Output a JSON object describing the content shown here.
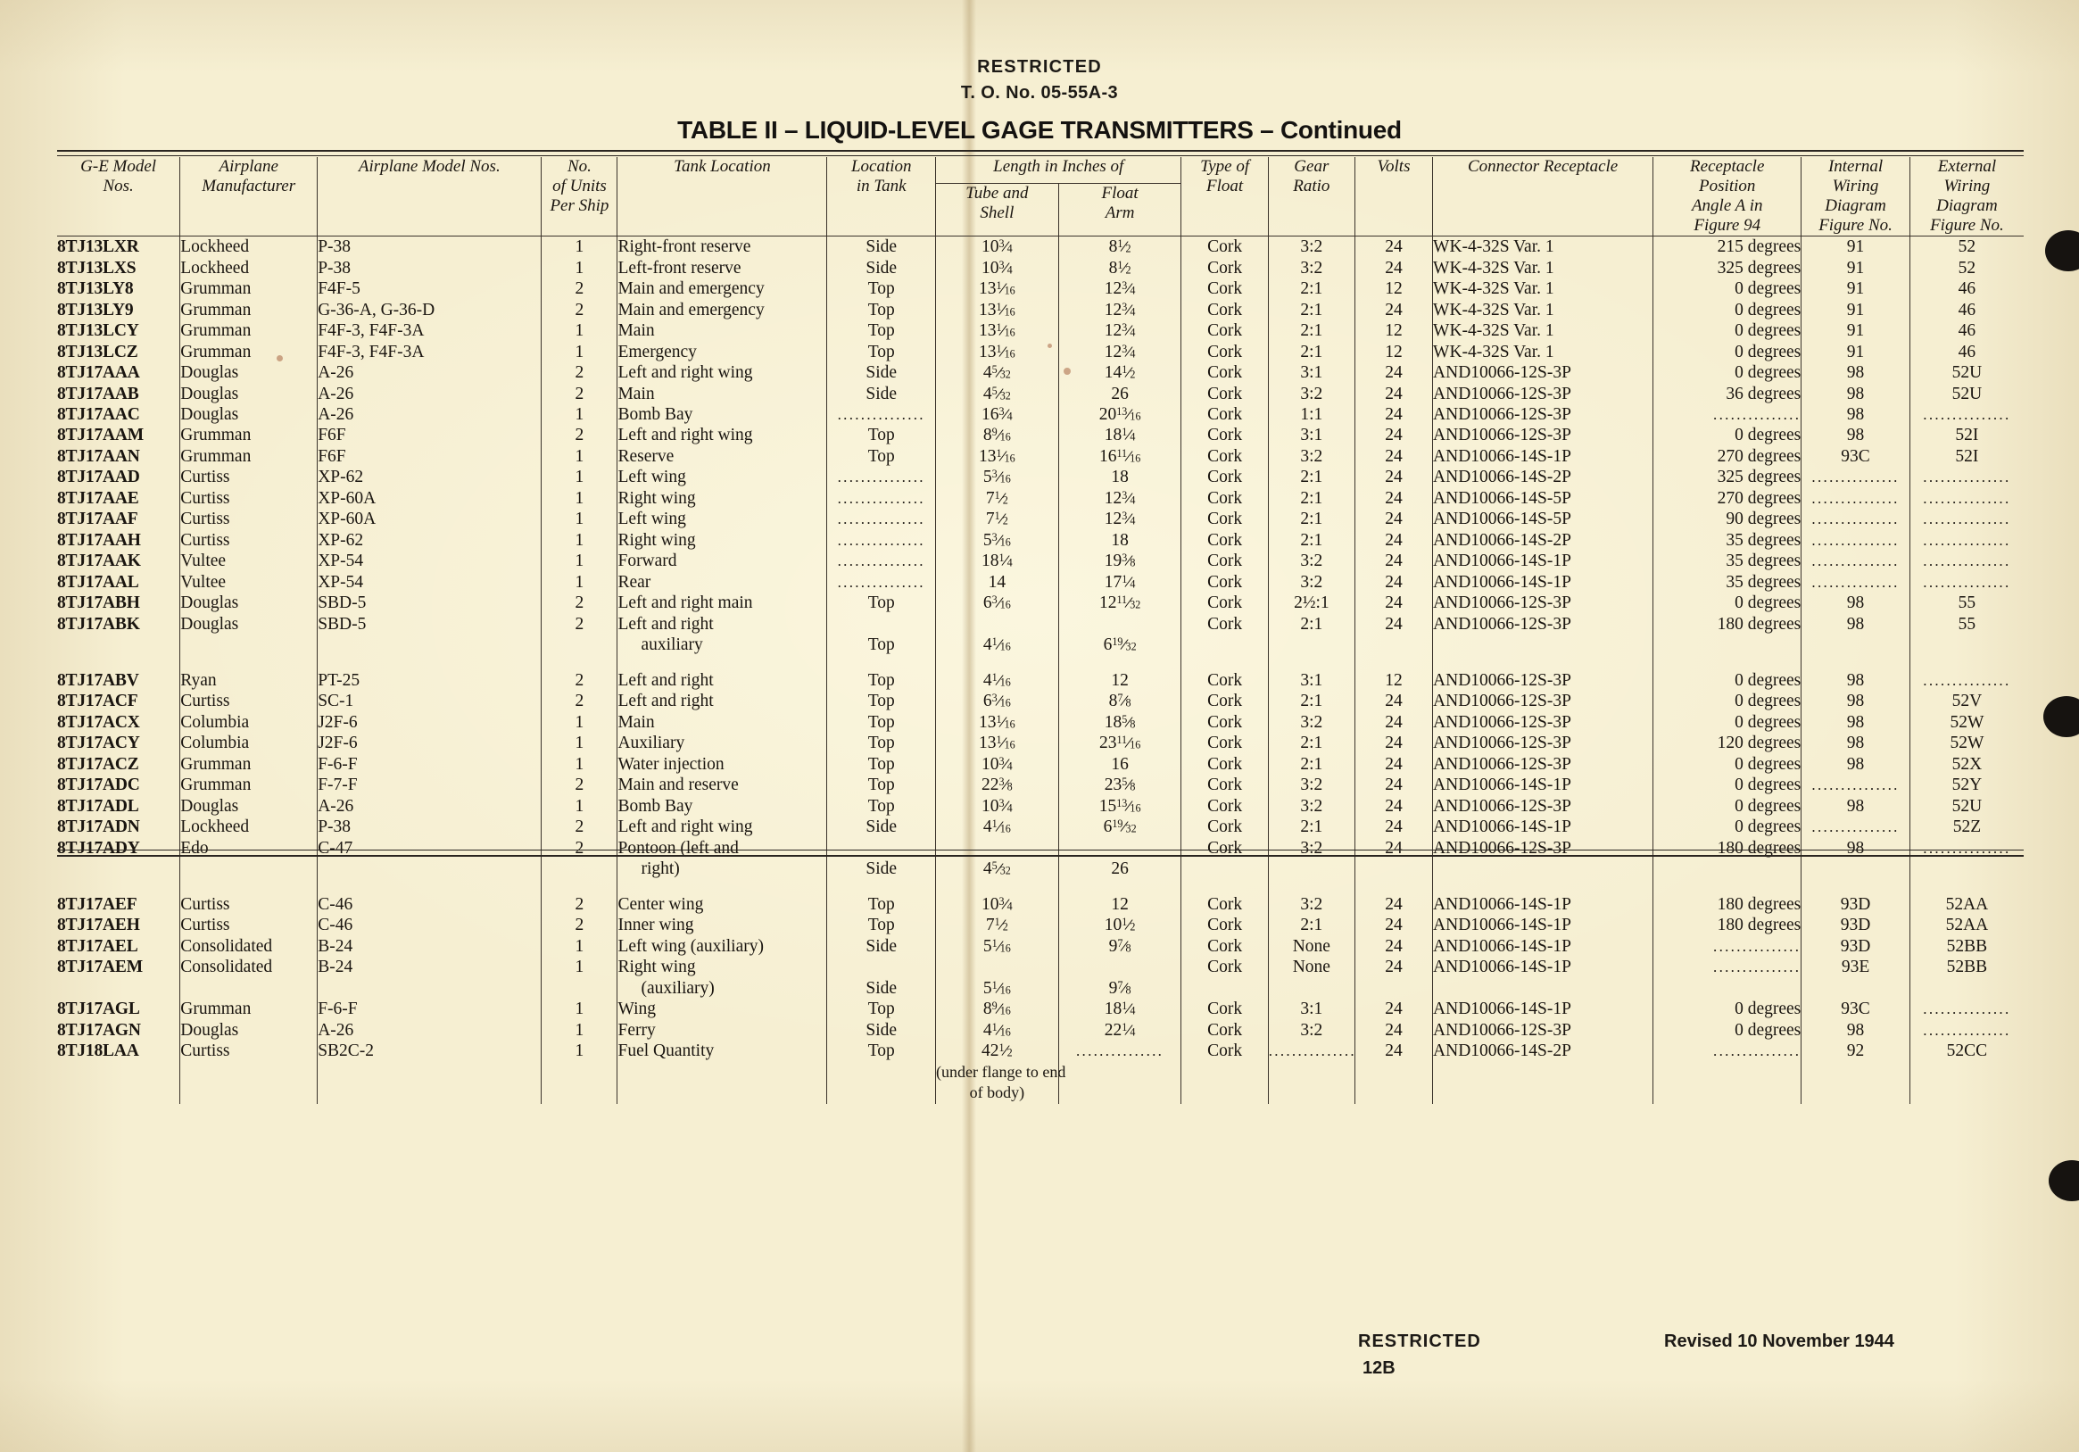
{
  "header": {
    "restricted": "RESTRICTED",
    "to_number": "T. O. No. 05-55A-3",
    "table_title": "TABLE II – LIQUID-LEVEL GAGE TRANSMITTERS – Continued"
  },
  "footer": {
    "restricted": "RESTRICTED",
    "page_number": "12B",
    "revised": "Revised 10 November 1944"
  },
  "table": {
    "columns": {
      "ge_model": "G-E Model Nos.",
      "manufacturer": "Airplane Manufacturer",
      "airplane_models": "Airplane Model Nos.",
      "units_per_ship": "No. of Units Per Ship",
      "tank_location": "Tank Location",
      "location_in_tank": "Location in Tank",
      "length_group": "Length in Inches of",
      "tube_and_shell": "Tube and Shell",
      "float_arm": "Float Arm",
      "type_of_float": "Type of Float",
      "gear_ratio": "Gear Ratio",
      "volts": "Volts",
      "connector_receptacle": "Connector Receptacle",
      "receptacle_position": "Receptacle Position Angle A in Figure 94",
      "internal_wiring": "Internal Wiring Diagram Figure No.",
      "external_wiring": "External Wiring Diagram Figure No."
    },
    "header_lines": {
      "ge_model": [
        "G-E Model",
        "Nos."
      ],
      "manufacturer": [
        "Airplane",
        "Manufacturer"
      ],
      "airplane_models": [
        "Airplane Model Nos."
      ],
      "units_per_ship": [
        "No.",
        "of Units",
        "Per Ship"
      ],
      "tank_location": [
        "Tank Location"
      ],
      "location_in_tank": [
        "Location",
        "in Tank"
      ],
      "length_group": [
        "Length in Inches of"
      ],
      "tube_and_shell": [
        "Tube and",
        "Shell"
      ],
      "float_arm": [
        "Float",
        "Arm"
      ],
      "type_of_float": [
        "Type of",
        "Float"
      ],
      "gear_ratio": [
        "Gear",
        "Ratio"
      ],
      "volts": [
        "Volts"
      ],
      "connector_receptacle": [
        "Connector Receptacle"
      ],
      "receptacle_position": [
        "Receptacle",
        "Position",
        "Angle A in",
        "Figure 94"
      ],
      "internal_wiring": [
        "Internal",
        "Wiring",
        "Diagram",
        "Figure No."
      ],
      "external_wiring": [
        "External",
        "Wiring",
        "Diagram",
        "Figure No."
      ]
    },
    "dots": "...............",
    "rows": [
      {
        "ge": "8TJ13LXR",
        "mfr": "Lockheed",
        "models": "P-38",
        "units": "1",
        "tank": "Right-front reserve",
        "loc": "Side",
        "tube": "10|3|4",
        "float": "8|1|2",
        "type": "Cork",
        "gear": "3:2",
        "volts": "24",
        "conn": "WK-4-32S Var. 1",
        "angle": "215 degrees",
        "intw": "91",
        "extw": "52"
      },
      {
        "ge": "8TJ13LXS",
        "mfr": "Lockheed",
        "models": "P-38",
        "units": "1",
        "tank": "Left-front reserve",
        "loc": "Side",
        "tube": "10|3|4",
        "float": "8|1|2",
        "type": "Cork",
        "gear": "3:2",
        "volts": "24",
        "conn": "WK-4-32S Var. 1",
        "angle": "325 degrees",
        "intw": "91",
        "extw": "52"
      },
      {
        "ge": "8TJ13LY8",
        "mfr": "Grumman",
        "models": "F4F-5",
        "units": "2",
        "tank": "Main and emergency",
        "loc": "Top",
        "tube": "13|1|16",
        "float": "12|3|4",
        "type": "Cork",
        "gear": "2:1",
        "volts": "12",
        "conn": "WK-4-32S Var. 1",
        "angle": "0 degrees",
        "intw": "91",
        "extw": "46"
      },
      {
        "ge": "8TJ13LY9",
        "mfr": "Grumman",
        "models": "G-36-A, G-36-D",
        "units": "2",
        "tank": "Main and emergency",
        "loc": "Top",
        "tube": "13|1|16",
        "float": "12|3|4",
        "type": "Cork",
        "gear": "2:1",
        "volts": "24",
        "conn": "WK-4-32S Var. 1",
        "angle": "0 degrees",
        "intw": "91",
        "extw": "46"
      },
      {
        "ge": "8TJ13LCY",
        "mfr": "Grumman",
        "models": "F4F-3, F4F-3A",
        "units": "1",
        "tank": "Main",
        "loc": "Top",
        "tube": "13|1|16",
        "float": "12|3|4",
        "type": "Cork",
        "gear": "2:1",
        "volts": "12",
        "conn": "WK-4-32S Var. 1",
        "angle": "0 degrees",
        "intw": "91",
        "extw": "46"
      },
      {
        "ge": "8TJ13LCZ",
        "mfr": "Grumman",
        "models": "F4F-3, F4F-3A",
        "units": "1",
        "tank": "Emergency",
        "loc": "Top",
        "tube": "13|1|16",
        "float": "12|3|4",
        "type": "Cork",
        "gear": "2:1",
        "volts": "12",
        "conn": "WK-4-32S Var. 1",
        "angle": "0 degrees",
        "intw": "91",
        "extw": "46"
      },
      {
        "ge": "8TJ17AAA",
        "mfr": "Douglas",
        "models": "A-26",
        "units": "2",
        "tank": "Left and right wing",
        "loc": "Side",
        "tube": "4|5|32",
        "float": "14|1|2",
        "type": "Cork",
        "gear": "3:1",
        "volts": "24",
        "conn": "AND10066-12S-3P",
        "angle": "0 degrees",
        "intw": "98",
        "extw": "52U"
      },
      {
        "ge": "8TJ17AAB",
        "mfr": "Douglas",
        "models": "A-26",
        "units": "2",
        "tank": "Main",
        "loc": "Side",
        "tube": "4|5|32",
        "float": "26",
        "type": "Cork",
        "gear": "3:2",
        "volts": "24",
        "conn": "AND10066-12S-3P",
        "angle": "36 degrees",
        "intw": "98",
        "extw": "52U"
      },
      {
        "ge": "8TJ17AAC",
        "mfr": "Douglas",
        "models": "A-26",
        "units": "1",
        "tank": "Bomb Bay",
        "loc": "DOTS",
        "tube": "16|3|4",
        "float": "20|13|16",
        "type": "Cork",
        "gear": "1:1",
        "volts": "24",
        "conn": "AND10066-12S-3P",
        "angle": "DOTS",
        "intw": "98",
        "extw": "DOTS"
      },
      {
        "ge": "8TJ17AAM",
        "mfr": "Grumman",
        "models": "F6F",
        "units": "2",
        "tank": "Left and right wing",
        "loc": "Top",
        "tube": "8|9|16",
        "float": "18|1|4",
        "type": "Cork",
        "gear": "3:1",
        "volts": "24",
        "conn": "AND10066-12S-3P",
        "angle": "0 degrees",
        "intw": "98",
        "extw": "52I"
      },
      {
        "ge": "8TJ17AAN",
        "mfr": "Grumman",
        "models": "F6F",
        "units": "1",
        "tank": "Reserve",
        "loc": "Top",
        "tube": "13|1|16",
        "float": "16|11|16",
        "type": "Cork",
        "gear": "3:2",
        "volts": "24",
        "conn": "AND10066-14S-1P",
        "angle": "270 degrees",
        "intw": "93C",
        "extw": "52I"
      },
      {
        "ge": "8TJ17AAD",
        "mfr": "Curtiss",
        "models": "XP-62",
        "units": "1",
        "tank": "Left wing",
        "loc": "DOTS",
        "tube": "5|3|16",
        "float": "18",
        "type": "Cork",
        "gear": "2:1",
        "volts": "24",
        "conn": "AND10066-14S-2P",
        "angle": "325 degrees",
        "intw": "DOTS",
        "extw": "DOTS"
      },
      {
        "ge": "8TJ17AAE",
        "mfr": "Curtiss",
        "models": "XP-60A",
        "units": "1",
        "tank": "Right wing",
        "loc": "DOTS",
        "tube": "7|1|2",
        "float": "12|3|4",
        "type": "Cork",
        "gear": "2:1",
        "volts": "24",
        "conn": "AND10066-14S-5P",
        "angle": "270 degrees",
        "intw": "DOTS",
        "extw": "DOTS"
      },
      {
        "ge": "8TJ17AAF",
        "mfr": "Curtiss",
        "models": "XP-60A",
        "units": "1",
        "tank": "Left wing",
        "loc": "DOTS",
        "tube": "7|1|2",
        "float": "12|3|4",
        "type": "Cork",
        "gear": "2:1",
        "volts": "24",
        "conn": "AND10066-14S-5P",
        "angle": "90 degrees",
        "intw": "DOTS",
        "extw": "DOTS"
      },
      {
        "ge": "8TJ17AAH",
        "mfr": "Curtiss",
        "models": "XP-62",
        "units": "1",
        "tank": "Right wing",
        "loc": "DOTS",
        "tube": "5|3|16",
        "float": "18",
        "type": "Cork",
        "gear": "2:1",
        "volts": "24",
        "conn": "AND10066-14S-2P",
        "angle": "35 degrees",
        "intw": "DOTS",
        "extw": "DOTS"
      },
      {
        "ge": "8TJ17AAK",
        "mfr": "Vultee",
        "models": "XP-54",
        "units": "1",
        "tank": "Forward",
        "loc": "DOTS",
        "tube": "18|1|4",
        "float": "19|3|8",
        "type": "Cork",
        "gear": "3:2",
        "volts": "24",
        "conn": "AND10066-14S-1P",
        "angle": "35 degrees",
        "intw": "DOTS",
        "extw": "DOTS"
      },
      {
        "ge": "8TJ17AAL",
        "mfr": "Vultee",
        "models": "XP-54",
        "units": "1",
        "tank": "Rear",
        "loc": "DOTS",
        "tube": "14",
        "float": "17|1|4",
        "type": "Cork",
        "gear": "3:2",
        "volts": "24",
        "conn": "AND10066-14S-1P",
        "angle": "35 degrees",
        "intw": "DOTS",
        "extw": "DOTS"
      },
      {
        "ge": "8TJ17ABH",
        "mfr": "Douglas",
        "models": "SBD-5",
        "units": "2",
        "tank": "Left and right main",
        "loc": "Top",
        "tube": "6|3|16",
        "float": "12|11|32",
        "type": "Cork",
        "gear": "2½:1",
        "volts": "24",
        "conn": "AND10066-12S-3P",
        "angle": "0 degrees",
        "intw": "98",
        "extw": "55"
      },
      {
        "ge": "8TJ17ABK",
        "mfr": "Douglas",
        "models": "SBD-5",
        "units": "2",
        "tank": "Left and right",
        "tank2": "auxiliary",
        "loc": "",
        "loc2": "Top",
        "tube": "",
        "tube2": "4|1|16",
        "float": "",
        "float2": "6|19|32",
        "type": "Cork",
        "gear": "2:1",
        "volts": "24",
        "conn": "AND10066-12S-3P",
        "angle": "180 degrees",
        "intw": "98",
        "extw": "55"
      },
      {
        "spacer": true
      },
      {
        "ge": "8TJ17ABV",
        "mfr": "Ryan",
        "models": "PT-25",
        "units": "2",
        "tank": "Left and right",
        "loc": "Top",
        "tube": "4|1|16",
        "float": "12",
        "type": "Cork",
        "gear": "3:1",
        "volts": "12",
        "conn": "AND10066-12S-3P",
        "angle": "0 degrees",
        "intw": "98",
        "extw": "DOTS"
      },
      {
        "ge": "8TJ17ACF",
        "mfr": "Curtiss",
        "models": "SC-1",
        "units": "2",
        "tank": "Left and right",
        "loc": "Top",
        "tube": "6|3|16",
        "float": "8|7|8",
        "type": "Cork",
        "gear": "2:1",
        "volts": "24",
        "conn": "AND10066-12S-3P",
        "angle": "0 degrees",
        "intw": "98",
        "extw": "52V"
      },
      {
        "ge": "8TJ17ACX",
        "mfr": "Columbia",
        "models": "J2F-6",
        "units": "1",
        "tank": "Main",
        "loc": "Top",
        "tube": "13|1|16",
        "float": "18|5|8",
        "type": "Cork",
        "gear": "3:2",
        "volts": "24",
        "conn": "AND10066-12S-3P",
        "angle": "0 degrees",
        "intw": "98",
        "extw": "52W"
      },
      {
        "ge": "8TJ17ACY",
        "mfr": "Columbia",
        "models": "J2F-6",
        "units": "1",
        "tank": "Auxiliary",
        "loc": "Top",
        "tube": "13|1|16",
        "float": "23|11|16",
        "type": "Cork",
        "gear": "2:1",
        "volts": "24",
        "conn": "AND10066-12S-3P",
        "angle": "120 degrees",
        "intw": "98",
        "extw": "52W"
      },
      {
        "ge": "8TJ17ACZ",
        "mfr": "Grumman",
        "models": "F-6-F",
        "units": "1",
        "tank": "Water injection",
        "loc": "Top",
        "tube": "10|3|4",
        "float": "16",
        "type": "Cork",
        "gear": "2:1",
        "volts": "24",
        "conn": "AND10066-12S-3P",
        "angle": "0 degrees",
        "intw": "98",
        "extw": "52X"
      },
      {
        "ge": "8TJ17ADC",
        "mfr": "Grumman",
        "models": "F-7-F",
        "units": "2",
        "tank": "Main and reserve",
        "loc": "Top",
        "tube": "22|3|8",
        "float": "23|5|8",
        "type": "Cork",
        "gear": "3:2",
        "volts": "24",
        "conn": "AND10066-14S-1P",
        "angle": "0 degrees",
        "intw": "DOTS",
        "extw": "52Y"
      },
      {
        "ge": "8TJ17ADL",
        "mfr": "Douglas",
        "models": "A-26",
        "units": "1",
        "tank": "Bomb Bay",
        "loc": "Top",
        "tube": "10|3|4",
        "float": "15|13|16",
        "type": "Cork",
        "gear": "3:2",
        "volts": "24",
        "conn": "AND10066-12S-3P",
        "angle": "0 degrees",
        "intw": "98",
        "extw": "52U"
      },
      {
        "ge": "8TJ17ADN",
        "mfr": "Lockheed",
        "models": "P-38",
        "units": "2",
        "tank": "Left and right wing",
        "loc": "Side",
        "tube": "4|1|16",
        "float": "6|19|32",
        "type": "Cork",
        "gear": "2:1",
        "volts": "24",
        "conn": "AND10066-14S-1P",
        "angle": "0 degrees",
        "intw": "DOTS",
        "extw": "52Z"
      },
      {
        "ge": "8TJ17ADY",
        "mfr": "Edo",
        "models": "C-47",
        "units": "2",
        "tank": "Pontoon (left and",
        "tank2": "right)",
        "loc": "",
        "loc2": "Side",
        "tube": "",
        "tube2": "4|5|32",
        "float": "",
        "float2": "26",
        "type": "Cork",
        "gear": "3:2",
        "volts": "24",
        "conn": "AND10066-12S-3P",
        "angle": "180 degrees",
        "intw": "98",
        "extw": "DOTS"
      },
      {
        "spacer": true
      },
      {
        "ge": "8TJ17AEF",
        "mfr": "Curtiss",
        "models": "C-46",
        "units": "2",
        "tank": "Center wing",
        "loc": "Top",
        "tube": "10|3|4",
        "float": "12",
        "type": "Cork",
        "gear": "3:2",
        "volts": "24",
        "conn": "AND10066-14S-1P",
        "angle": "180 degrees",
        "intw": "93D",
        "extw": "52AA"
      },
      {
        "ge": "8TJ17AEH",
        "mfr": "Curtiss",
        "models": "C-46",
        "units": "2",
        "tank": "Inner wing",
        "loc": "Top",
        "tube": "7|1|2",
        "float": "10|1|2",
        "type": "Cork",
        "gear": "2:1",
        "volts": "24",
        "conn": "AND10066-14S-1P",
        "angle": "180 degrees",
        "intw": "93D",
        "extw": "52AA"
      },
      {
        "ge": "8TJ17AEL",
        "mfr": "Consolidated",
        "models": "B-24",
        "units": "1",
        "tank": "Left wing (auxiliary)",
        "loc": "Side",
        "tube": "5|1|16",
        "float": "9|7|8",
        "type": "Cork",
        "gear": "None",
        "volts": "24",
        "conn": "AND10066-14S-1P",
        "angle": "DOTS",
        "intw": "93D",
        "extw": "52BB"
      },
      {
        "ge": "8TJ17AEM",
        "mfr": "Consolidated",
        "models": "B-24",
        "units": "1",
        "tank": "Right wing",
        "tank2": "(auxiliary)",
        "loc": "",
        "loc2": "Side",
        "tube": "",
        "tube2": "5|1|16",
        "float": "",
        "float2": "9|7|8",
        "type": "Cork",
        "gear": "None",
        "volts": "24",
        "conn": "AND10066-14S-1P",
        "angle": "DOTS",
        "intw": "93E",
        "extw": "52BB"
      },
      {
        "ge": "8TJ17AGL",
        "mfr": "Grumman",
        "models": "F-6-F",
        "units": "1",
        "tank": "Wing",
        "loc": "Top",
        "tube": "8|9|16",
        "float": "18|1|4",
        "type": "Cork",
        "gear": "3:1",
        "volts": "24",
        "conn": "AND10066-14S-1P",
        "angle": "0 degrees",
        "intw": "93C",
        "extw": "DOTS"
      },
      {
        "ge": "8TJ17AGN",
        "mfr": "Douglas",
        "models": "A-26",
        "units": "1",
        "tank": "Ferry",
        "loc": "Side",
        "tube": "4|1|16",
        "float": "22|1|4",
        "type": "Cork",
        "gear": "3:2",
        "volts": "24",
        "conn": "AND10066-12S-3P",
        "angle": "0 degrees",
        "intw": "98",
        "extw": "DOTS"
      },
      {
        "ge": "8TJ18LAA",
        "mfr": "Curtiss",
        "models": "SB2C-2",
        "units": "1",
        "tank": "Fuel Quantity",
        "loc": "Top",
        "tube": "42|1|2",
        "tube_note1": "(under flange to end",
        "tube_note2": "of body)",
        "float": "DOTS",
        "type": "Cork",
        "gear": "DOTS",
        "volts": "24",
        "conn": "AND10066-14S-2P",
        "angle": "DOTS",
        "intw": "92",
        "extw": "52CC"
      }
    ]
  }
}
